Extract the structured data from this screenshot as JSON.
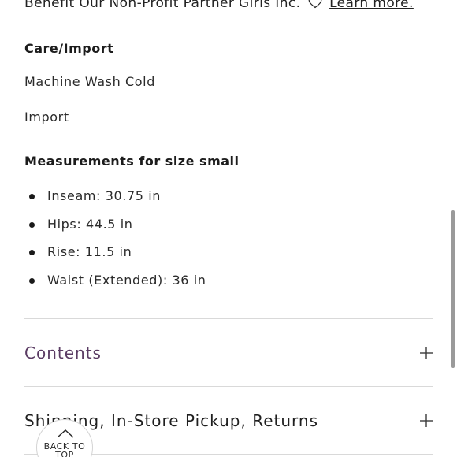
{
  "description_partner": {
    "text": "Benefit Our Non-Profit Partner Girls Inc.",
    "link_label": "Learn more."
  },
  "care": {
    "heading": "Care/Import",
    "lines": [
      "Machine Wash Cold",
      "Import"
    ]
  },
  "measurements": {
    "heading": "Measurements for size small",
    "items": [
      "Inseam: 30.75 in",
      "Hips: 44.5 in",
      "Rise: 11.5 in",
      "Waist (Extended): 36 in"
    ]
  },
  "accordions": [
    {
      "label": "Contents",
      "color": "#5a3b63",
      "icon": "plus-icon"
    },
    {
      "label": "Shipping, In-Store Pickup, Returns",
      "color": "#1f1f1f",
      "icon": "plus-icon"
    }
  ],
  "back_to_top": {
    "label": "BACK TO TOP",
    "icon": "chevron-up-icon"
  },
  "colors": {
    "accent": "#5a3b63",
    "text": "#1f1f1f",
    "divider": "#d9d9d9"
  }
}
